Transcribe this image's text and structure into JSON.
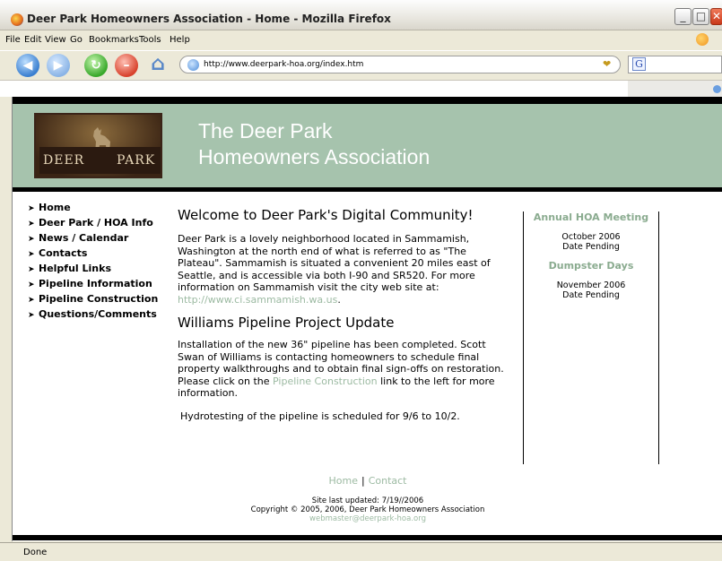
{
  "window": {
    "title": "Deer Park Homeowners Association - Home - Mozilla Firefox",
    "min_label": "_",
    "max_label": "□",
    "close_label": "✕"
  },
  "menu": {
    "file": "File",
    "edit": "Edit",
    "view": "View",
    "go": "Go",
    "bookmarks": "Bookmarks",
    "tools": "Tools",
    "help": "Help"
  },
  "toolbar": {
    "url": "http://www.deerpark-hoa.org/index.htm",
    "search_value": ""
  },
  "banner": {
    "logo_left": "DEER",
    "logo_right": "PARK",
    "title_line1": "The Deer Park",
    "title_line2": "Homeowners Association"
  },
  "nav": {
    "items": [
      "Home",
      "Deer Park / HOA Info",
      "News / Calendar",
      "Contacts",
      "Helpful Links",
      "Pipeline Information",
      "Pipeline Construction",
      "Questions/Comments"
    ]
  },
  "main": {
    "heading1": "Welcome to Deer Park's Digital Community!",
    "para1_text": "Deer Park is a lovely neighborhood located in Sammamish, Washington at the north end of what is referred to as \"The Plateau\".  Sammamish is situated a convenient 20 miles east of Seattle, and is accessible via both I-90 and SR520.  For more information on Sammamish visit the city web site at: ",
    "para1_link": "http://www.ci.sammamish.wa.us",
    "para1_end": ".",
    "heading2": "Williams Pipeline Project Update",
    "para2_text": "Installation of the new 36\" pipeline has been completed. Scott Swan of Williams is contacting homeowners to schedule final property walkthroughs and to obtain final sign-offs on restoration.  Please click on the ",
    "para2_link": "Pipeline Construction",
    "para2_end": " link to the left for more information.",
    "para3": "Hydrotesting of the pipeline is scheduled for 9/6 to 10/2."
  },
  "events": [
    {
      "title": "Annual HOA Meeting",
      "date": "October 2006",
      "status": "Date Pending"
    },
    {
      "title": "Dumpster Days",
      "date": "November 2006",
      "status": "Date Pending"
    }
  ],
  "footer": {
    "home": "Home",
    "sep": "|",
    "contact": "Contact",
    "updated": "Site last updated: 7/19//2006",
    "copyright": "Copyright © 2005, 2006, Deer Park Homeowners Association",
    "email": "webmaster@deerpark-hoa.org"
  },
  "status": {
    "text": "Done"
  }
}
